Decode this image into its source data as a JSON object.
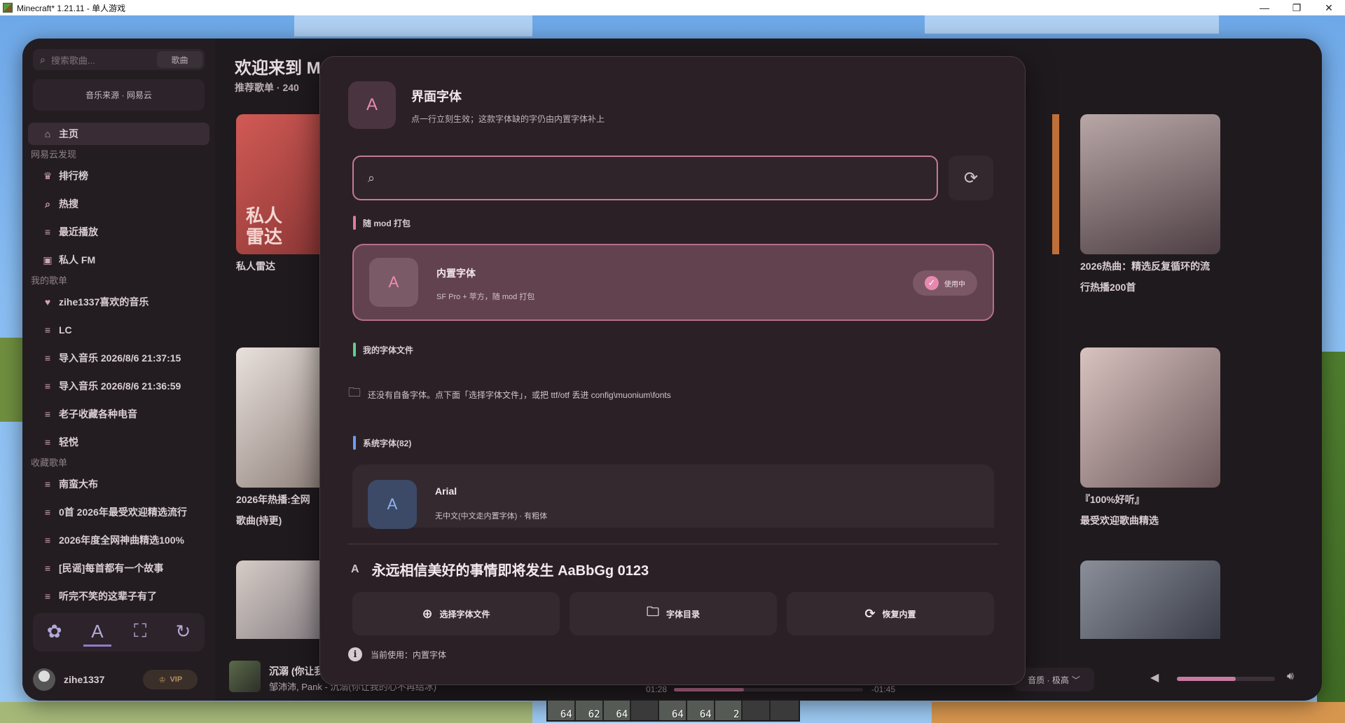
{
  "window": {
    "title": "Minecraft* 1.21.11 - 单人游戏",
    "controls": [
      "—",
      "❐",
      "✕"
    ]
  },
  "sidebar": {
    "search_placeholder": "搜索歌曲...",
    "search_scope": "歌曲",
    "source_label": "音乐来源 · 网易云",
    "home_label": "主页",
    "section_discover": "网易云发现",
    "discover_items": [
      "排行榜",
      "热搜",
      "最近播放",
      "私人 FM"
    ],
    "section_my_playlists": "我的歌单",
    "my_playlists": [
      "zihe1337喜欢的音乐",
      "LC",
      "导入音乐 2026/8/6 21:37:15",
      "导入音乐 2026/8/6 21:36:59",
      "老子收藏各种电音",
      "轻悦"
    ],
    "section_collected": "收藏歌单",
    "collected_playlists": [
      "南蛮大布",
      "0首  2026年最受欢迎精选流行",
      "2026年度全网神曲精选100%",
      "[民谣]每首都有一个故事",
      "听完不笑的这辈子有了"
    ],
    "tools": [
      "palette-icon",
      "font-icon",
      "fullscreen-icon",
      "refresh-icon"
    ],
    "username": "zihe1337",
    "vip_label": "VIP"
  },
  "content": {
    "welcome": "欢迎来到 M",
    "recommend_count": "推荐歌单 · 240",
    "cards": [
      {
        "title_line1": "私人雷达",
        "title_line2": "",
        "overlay": "私人\n雷达"
      },
      {
        "title_line1": "2026热曲：精选反复循环的流",
        "title_line2": "行热播200首"
      },
      {
        "title_line1": "2026年热播:全网",
        "title_line2": "歌曲(持更)"
      },
      {
        "title_line1": "『100%好听』",
        "title_line2": "最受欢迎歌曲精选"
      }
    ]
  },
  "player": {
    "track_title": "沉溺 (你让我",
    "track_artist": "邹沛沛, Pank - 沉溺(你让我的心不再结冰)",
    "current_time": "01:28",
    "remaining_time": "-01:45",
    "progress": 0.37,
    "quality": "音质 · 极高",
    "volume": 0.6
  },
  "modal": {
    "icon_glyph": "A",
    "title": "界面字体",
    "subtitle": "点一行立刻生效；这款字体缺的字仍由内置字体补上",
    "search_value": "",
    "section_bundled": "随 mod 打包",
    "bundled_font": {
      "name": "内置字体",
      "desc": "SF Pro + 苹方，随 mod 打包",
      "status": "使用中"
    },
    "section_mine": "我的字体文件",
    "empty_note": "还没有自备字体。点下面「选择字体文件」，或把 ttf/otf 丢进 config\\muonium\\fonts",
    "section_system": "系统字体(82)",
    "system_fonts": [
      {
        "name": "Arial",
        "desc": "无中文(中文走内置字体) · 有粗体"
      }
    ],
    "preview_text": "永远相信美好的事情即将发生  AaBbGg 0123",
    "buttons": {
      "choose": "选择字体文件",
      "folder": "字体目录",
      "restore": "恢复内置"
    },
    "current_label": "当前使用：内置字体"
  },
  "hotbar": {
    "counts": [
      "64",
      "62",
      "64",
      "",
      "64",
      "64",
      "2",
      "",
      ""
    ]
  },
  "colors": {
    "accent": "#c47a98",
    "bundled_bar": "#e07aa5",
    "mine_bar": "#5fd08a",
    "system_bar": "#6a9ef0"
  }
}
